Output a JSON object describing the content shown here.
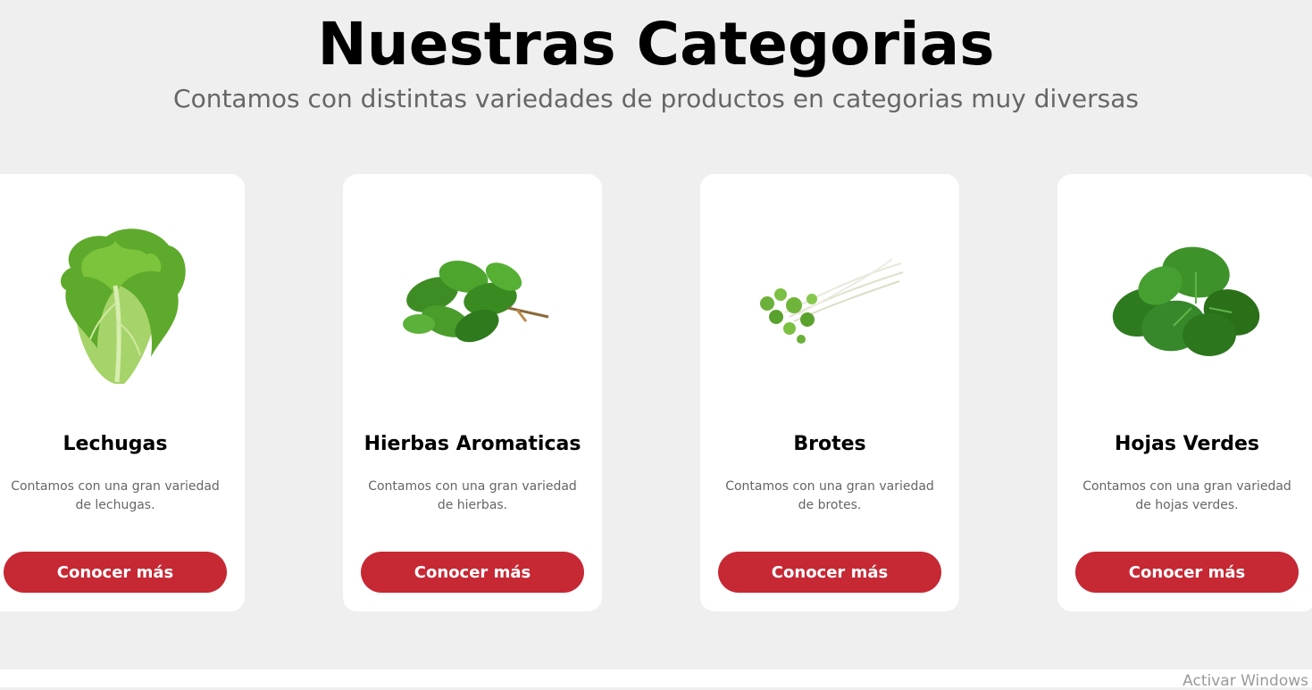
{
  "header": {
    "title": "Nuestras Categorias",
    "subtitle": "Contamos con distintas variedades de productos en categorias muy diversas"
  },
  "cards": [
    {
      "title": "Lechugas",
      "description": "Contamos con una gran variedad de lechugas.",
      "button": "Conocer más",
      "image": "lettuce-image"
    },
    {
      "title": "Hierbas Aromaticas",
      "description": "Contamos con una gran variedad de hierbas.",
      "button": "Conocer más",
      "image": "basil-image"
    },
    {
      "title": "Brotes",
      "description": "Contamos con una gran variedad de brotes.",
      "button": "Conocer más",
      "image": "sprouts-image"
    },
    {
      "title": "Hojas Verdes",
      "description": "Contamos con una gran variedad de hojas verdes.",
      "button": "Conocer más",
      "image": "spinach-image"
    }
  ],
  "watermark": "Activar Windows",
  "colors": {
    "background": "#efefef",
    "card": "#ffffff",
    "button": "#c62834",
    "title": "#000000",
    "muted_text": "#666666"
  }
}
